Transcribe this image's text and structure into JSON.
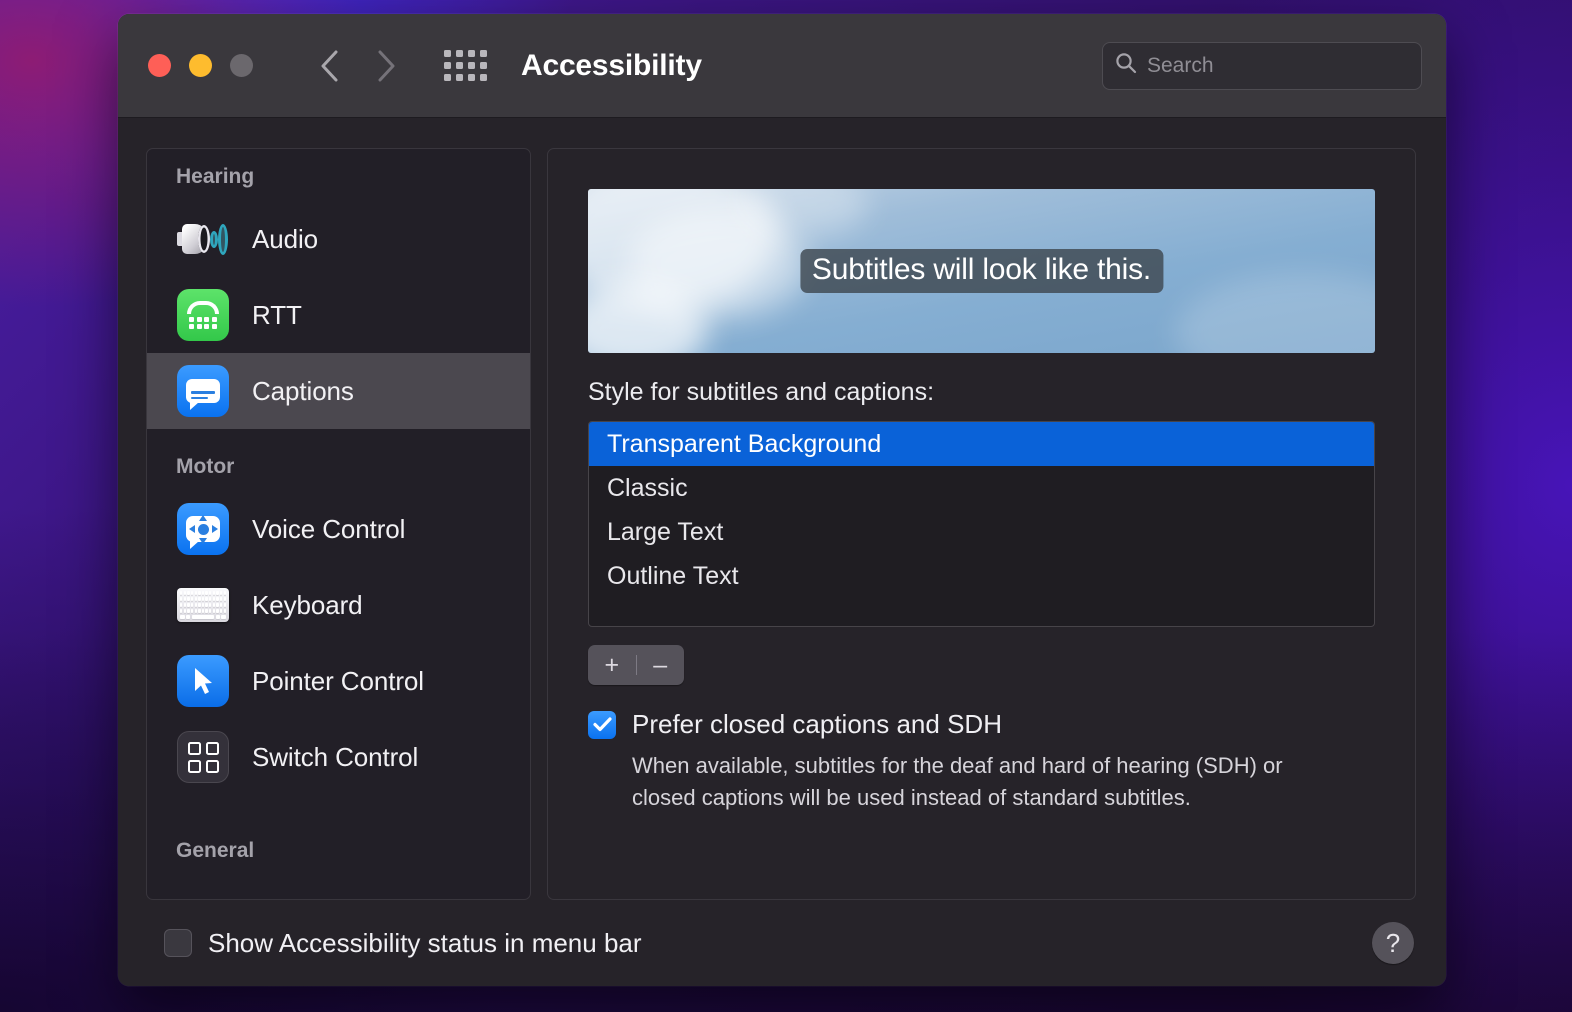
{
  "window": {
    "title": "Accessibility",
    "traffic_lights": [
      "close",
      "minimize",
      "zoom"
    ],
    "back_label": "Back",
    "forward_label": "Forward",
    "grid_label": "Show All"
  },
  "search": {
    "placeholder": "Search",
    "value": ""
  },
  "sidebar": {
    "groups": [
      {
        "label": "Hearing",
        "items": [
          {
            "label": "Audio",
            "icon": "audio-icon",
            "selected": false
          },
          {
            "label": "RTT",
            "icon": "rtt-icon",
            "selected": false
          },
          {
            "label": "Captions",
            "icon": "captions-icon",
            "selected": true
          }
        ]
      },
      {
        "label": "Motor",
        "items": [
          {
            "label": "Voice Control",
            "icon": "voice-control-icon",
            "selected": false
          },
          {
            "label": "Keyboard",
            "icon": "keyboard-icon",
            "selected": false
          },
          {
            "label": "Pointer Control",
            "icon": "pointer-control-icon",
            "selected": false
          },
          {
            "label": "Switch Control",
            "icon": "switch-control-icon",
            "selected": false
          }
        ]
      },
      {
        "label": "General",
        "items": []
      }
    ]
  },
  "main": {
    "preview": {
      "subtitle_text": "Subtitles will look like this.",
      "subtitle_bg": "#3e4850",
      "subtitle_color": "#ffffff"
    },
    "style_label": "Style for subtitles and captions:",
    "styles": [
      {
        "label": "Transparent Background",
        "selected": true
      },
      {
        "label": "Classic",
        "selected": false
      },
      {
        "label": "Large Text",
        "selected": false
      },
      {
        "label": "Outline Text",
        "selected": false
      }
    ],
    "selection_color": "#0a62d8",
    "add_label": "+",
    "remove_label": "–",
    "prefer_checkbox": {
      "label": "Prefer closed captions and SDH",
      "checked": true,
      "description": "When available, subtitles for the deaf and hard of hearing (SDH) or closed captions will be used instead of standard subtitles."
    }
  },
  "footer": {
    "menu_bar_checkbox": {
      "label": "Show Accessibility status in menu bar",
      "checked": false
    },
    "help_label": "?"
  }
}
